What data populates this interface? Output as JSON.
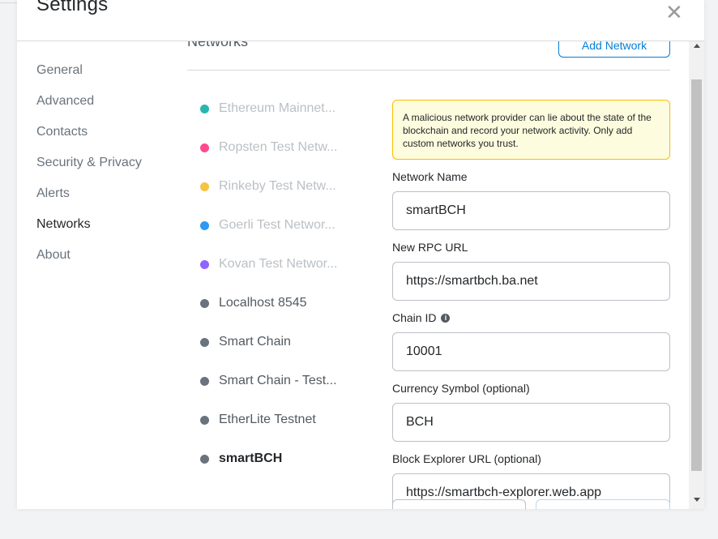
{
  "header": {
    "title": "Settings",
    "close_icon": "close-icon",
    "close_glyph": "✕"
  },
  "tabs": [
    {
      "label": "General",
      "active": false
    },
    {
      "label": "Advanced",
      "active": false
    },
    {
      "label": "Contacts",
      "active": false
    },
    {
      "label": "Security & Privacy",
      "active": false
    },
    {
      "label": "Alerts",
      "active": false
    },
    {
      "label": "Networks",
      "active": true
    },
    {
      "label": "About",
      "active": false
    }
  ],
  "networks_section": {
    "title": "Networks",
    "add_network_label": "Add Network",
    "items": [
      {
        "label": "Ethereum Mainnet...",
        "color": "#29b6af",
        "type": "default"
      },
      {
        "label": "Ropsten Test Netw...",
        "color": "#ff4a8d",
        "type": "default"
      },
      {
        "label": "Rinkeby Test Netw...",
        "color": "#f6c343",
        "type": "default"
      },
      {
        "label": "Goerli Test Networ...",
        "color": "#3099f2",
        "type": "default"
      },
      {
        "label": "Kovan Test Networ...",
        "color": "#9064ff",
        "type": "default"
      },
      {
        "label": "Localhost 8545",
        "color": "#6a737d",
        "type": "custom"
      },
      {
        "label": "Smart Chain",
        "color": "#6a737d",
        "type": "custom"
      },
      {
        "label": "Smart Chain - Test...",
        "color": "#6a737d",
        "type": "custom"
      },
      {
        "label": "EtherLite Testnet",
        "color": "#6a737d",
        "type": "custom"
      },
      {
        "label": "smartBCH",
        "color": "#6a737d",
        "type": "selected"
      }
    ]
  },
  "form": {
    "warning": "A malicious network provider can lie about the state of the blockchain and record your network activity. Only add custom networks you trust.",
    "network_name_label": "Network Name",
    "network_name_value": "smartBCH",
    "rpc_url_label": "New RPC URL",
    "rpc_url_value": "https://smartbch.ba.net",
    "chain_id_label": "Chain ID",
    "chain_id_info_icon": "info-icon",
    "chain_id_info_glyph": "i",
    "chain_id_value": "10001",
    "currency_symbol_label": "Currency Symbol (optional)",
    "currency_symbol_value": "BCH",
    "block_explorer_label": "Block Explorer URL (optional)",
    "block_explorer_value": "https://smartbch-explorer.web.app"
  },
  "scrollbar": {
    "up_icon": "scroll-up-arrow-icon",
    "down_icon": "scroll-down-arrow-icon"
  }
}
